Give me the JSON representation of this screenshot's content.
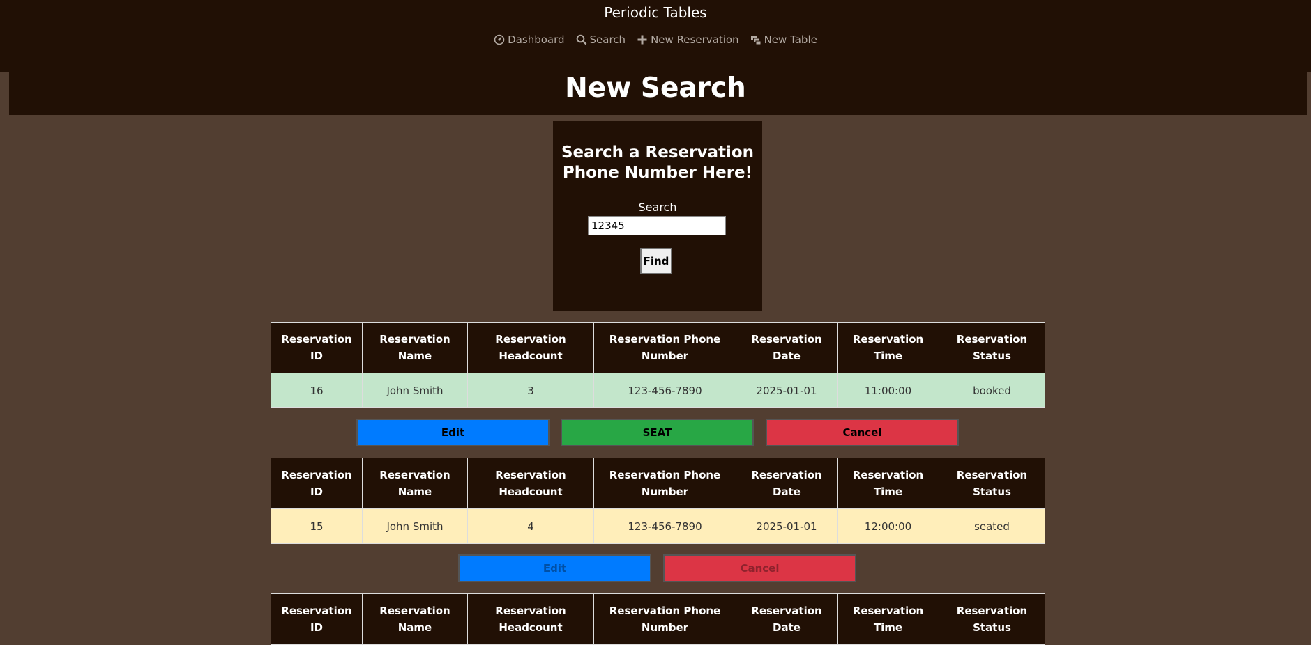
{
  "nav": {
    "brand": "Periodic Tables",
    "links": [
      {
        "label": "Dashboard",
        "icon": "dashboard-icon"
      },
      {
        "label": "Search",
        "icon": "search-icon"
      },
      {
        "label": "New Reservation",
        "icon": "plus-icon"
      },
      {
        "label": "New Table",
        "icon": "layers-icon"
      }
    ]
  },
  "page": {
    "title": "New Search"
  },
  "search": {
    "title_line1": "Search a Reservation",
    "title_line2": "Phone Number Here!",
    "label": "Search",
    "value": "12345",
    "find_label": "Find"
  },
  "table_headers": {
    "id": [
      "Reservation",
      "ID"
    ],
    "name": [
      "Reservation",
      "Name"
    ],
    "headcount": [
      "Reservation",
      "Headcount"
    ],
    "phone": [
      "Reservation Phone",
      "Number"
    ],
    "date": [
      "Reservation",
      "Date"
    ],
    "time": [
      "Reservation",
      "Time"
    ],
    "status": [
      "Reservation",
      "Status"
    ]
  },
  "reservations": [
    {
      "id": "16",
      "name": "John Smith",
      "headcount": "3",
      "phone": "123-456-7890",
      "date": "2025-01-01",
      "time": "11:00:00",
      "status": "booked"
    },
    {
      "id": "15",
      "name": "John Smith",
      "headcount": "4",
      "phone": "123-456-7890",
      "date": "2025-01-01",
      "time": "12:00:00",
      "status": "seated"
    }
  ],
  "actions": {
    "edit": "Edit",
    "seat": "SEAT",
    "cancel": "Cancel"
  },
  "colors": {
    "background": "#523e31",
    "header": "#211005",
    "booked_row": "#c3e6cb",
    "seated_row": "#ffeeba",
    "edit_button": "#007bff",
    "seat_button": "#28a745",
    "cancel_button": "#dc3545"
  }
}
